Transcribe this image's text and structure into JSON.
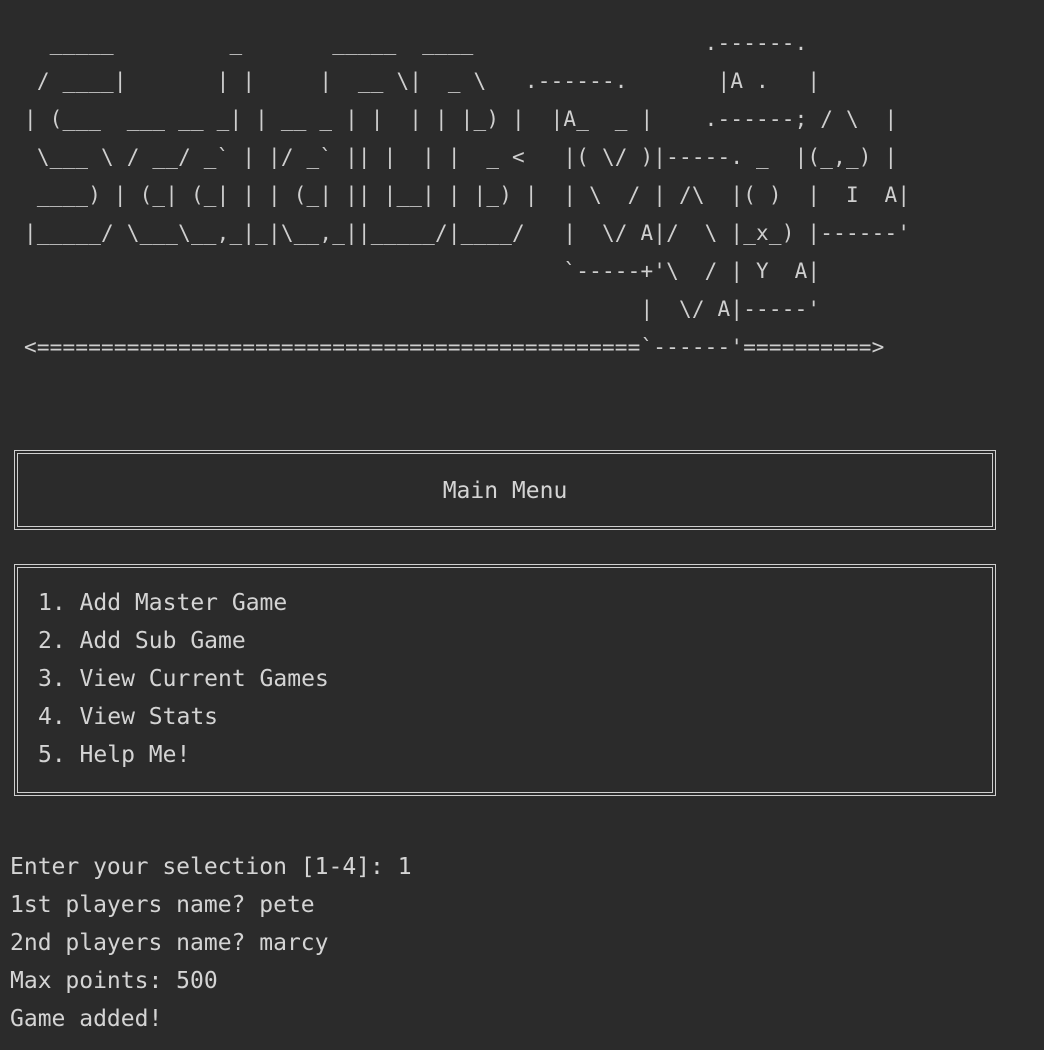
{
  "banner": {
    "ascii": "  _____         _       _____  ____                  .------.\n / ____|       | |     |  __ \\|  _ \\   .------.       |A .   |\n| (___  ___ __ _| | __ _ | |  | | |_) |  |A_  _ |    .------; / \\  |\n \\___ \\ / __/ _` | |/ _` || |  | |  _ <   |( \\/ )|-----. _  |(_,_) |\n ____) | (_| (_| | | (_| || |__| | |_) |  | \\  / | /\\  |( )  |  I  A|\n|_____/ \\___\\__,_|_|\\__,_||_____/|____/   |  \\/ A|/  \\ |_x_) |------'\n                                          `-----+'\\  / | Y  A|\n                                                |  \\/ A|-----'\n<===============================================`------'==========>"
  },
  "title_box": {
    "label": "Main Menu"
  },
  "menu": {
    "items": [
      "1. Add Master Game",
      "2. Add Sub Game",
      "3. View Current Games",
      "4. View Stats",
      "5. Help Me!"
    ]
  },
  "console": {
    "lines": [
      "Enter your selection [1-4]: 1",
      "1st players name? pete",
      "2nd players name? marcy",
      "Max points: 500",
      "Game added!"
    ]
  }
}
